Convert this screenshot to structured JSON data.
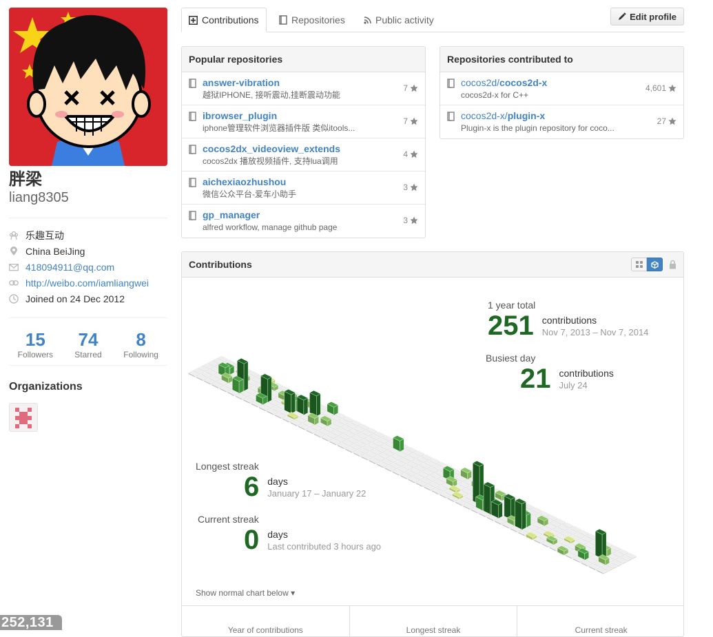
{
  "profile": {
    "fullname": "胖梁",
    "username": "liang8305",
    "details": [
      {
        "icon": "organization-icon",
        "text": "乐趣互动",
        "link": false
      },
      {
        "icon": "location-icon",
        "text": "China BeiJing",
        "link": false
      },
      {
        "icon": "mail-icon",
        "text": "418094911@qq.com",
        "link": true
      },
      {
        "icon": "link-icon",
        "text": "http://weibo.com/iamliangwei",
        "link": true
      },
      {
        "icon": "clock-icon",
        "text": "Joined on 24 Dec 2012",
        "link": false
      }
    ],
    "stats": [
      {
        "num": "15",
        "label": "Followers"
      },
      {
        "num": "74",
        "label": "Starred"
      },
      {
        "num": "8",
        "label": "Following"
      }
    ],
    "organizations_title": "Organizations"
  },
  "bottom_badge": "252,131",
  "tabs": [
    {
      "label": "Contributions",
      "icon": "plus-square-icon",
      "selected": true
    },
    {
      "label": "Repositories",
      "icon": "book-icon",
      "selected": false
    },
    {
      "label": "Public activity",
      "icon": "rss-icon",
      "selected": false
    }
  ],
  "edit_profile": "Edit profile",
  "popular": {
    "title": "Popular repositories",
    "repos": [
      {
        "owner": "",
        "name": "answer-vibration",
        "desc": "越狱IPHONE, 接听震动,挂断震动功能",
        "stars": "7"
      },
      {
        "owner": "",
        "name": "ibrowser_plugin",
        "desc": "iphone管理软件浏览器插件版 类似itools...",
        "stars": "7"
      },
      {
        "owner": "",
        "name": "cocos2dx_videoview_extends",
        "desc": "cocos2dx 播放视频插件, 支持lua调用",
        "stars": "4"
      },
      {
        "owner": "",
        "name": "aichexiaozhushou",
        "desc": "微信公众平台-爱车小助手",
        "stars": "3"
      },
      {
        "owner": "",
        "name": "gp_manager",
        "desc": "alfred workflow, manage github page",
        "stars": "3"
      }
    ]
  },
  "contributed": {
    "title": "Repositories contributed to",
    "repos": [
      {
        "owner": "cocos2d/",
        "name": "cocos2d-x",
        "desc": "cocos2d-x for C++",
        "stars": "4,601"
      },
      {
        "owner": "cocos2d-x/",
        "name": "plugin-x",
        "desc": "Plugin-x is the plugin repository for coco...",
        "stars": "27"
      }
    ]
  },
  "contributions": {
    "title": "Contributions",
    "year_total_label": "1 year total",
    "year_total": "251",
    "year_total_unit": "contributions",
    "year_total_range": "Nov 7, 2013 – Nov 7, 2014",
    "busiest_label": "Busiest day",
    "busiest": "21",
    "busiest_unit": "contributions",
    "busiest_date": "July 24",
    "longest_label": "Longest streak",
    "longest": "6",
    "longest_unit": "days",
    "longest_range": "January 17 – January 22",
    "current_label": "Current streak",
    "current": "0",
    "current_unit": "days",
    "current_note": "Last contributed 3 hours ago",
    "show_normal": "Show normal chart below ▾",
    "footer": [
      "Year of contributions",
      "Longest streak",
      "Current streak"
    ],
    "colors": {
      "empty": "#eeeeee",
      "l1": "#d6e685",
      "l2": "#8cc665",
      "l3": "#44a340",
      "l4": "#1e6823"
    }
  }
}
